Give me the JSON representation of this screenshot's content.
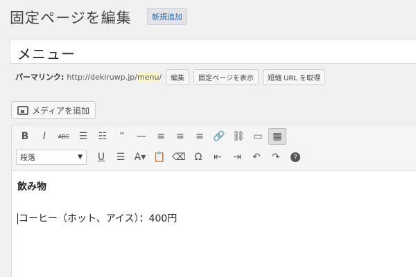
{
  "header": {
    "title": "固定ページを編集",
    "add_new_label": "新規追加"
  },
  "title_field": {
    "value": "メニュー"
  },
  "permalink": {
    "label": "パーマリンク:",
    "base_url": "http://dekiruwp.jp/",
    "slug": "menu",
    "trailing": "/",
    "edit_label": "編集",
    "view_label": "固定ページを表示",
    "shortlink_label": "短縮 URL を取得"
  },
  "media": {
    "add_media_label": "メディアを追加"
  },
  "toolbar": {
    "row1": [
      {
        "icon": "bold-icon",
        "glyph": "B"
      },
      {
        "icon": "italic-icon",
        "glyph": "I"
      },
      {
        "icon": "strikethrough-icon",
        "glyph": "ABC"
      },
      {
        "icon": "bullet-list-icon",
        "glyph": "☰"
      },
      {
        "icon": "numbered-list-icon",
        "glyph": "☷"
      },
      {
        "icon": "blockquote-icon",
        "glyph": "“"
      },
      {
        "icon": "horizontal-rule-icon",
        "glyph": "—"
      },
      {
        "icon": "align-left-icon",
        "glyph": "≡"
      },
      {
        "icon": "align-center-icon",
        "glyph": "≡"
      },
      {
        "icon": "align-right-icon",
        "glyph": "≡"
      },
      {
        "icon": "insert-link-icon",
        "glyph": "🔗"
      },
      {
        "icon": "unlink-icon",
        "glyph": "⛓"
      },
      {
        "icon": "read-more-icon",
        "glyph": "▭"
      },
      {
        "icon": "toolbar-toggle-icon",
        "glyph": "▦"
      }
    ],
    "format_select": "段落",
    "row2": [
      {
        "icon": "underline-icon",
        "glyph": "U"
      },
      {
        "icon": "justify-icon",
        "glyph": "☰"
      },
      {
        "icon": "text-color-icon",
        "glyph": "A▾"
      },
      {
        "icon": "paste-text-icon",
        "glyph": "📋"
      },
      {
        "icon": "clear-formatting-icon",
        "glyph": "⌫"
      },
      {
        "icon": "special-character-icon",
        "glyph": "Ω"
      },
      {
        "icon": "outdent-icon",
        "glyph": "⇤"
      },
      {
        "icon": "indent-icon",
        "glyph": "⇥"
      },
      {
        "icon": "undo-icon",
        "glyph": "↶"
      },
      {
        "icon": "redo-icon",
        "glyph": "↷"
      },
      {
        "icon": "help-icon",
        "glyph": "?"
      }
    ]
  },
  "content": {
    "heading": "飲み物",
    "line1": "コーヒー（ホット、アイス）：400円"
  }
}
